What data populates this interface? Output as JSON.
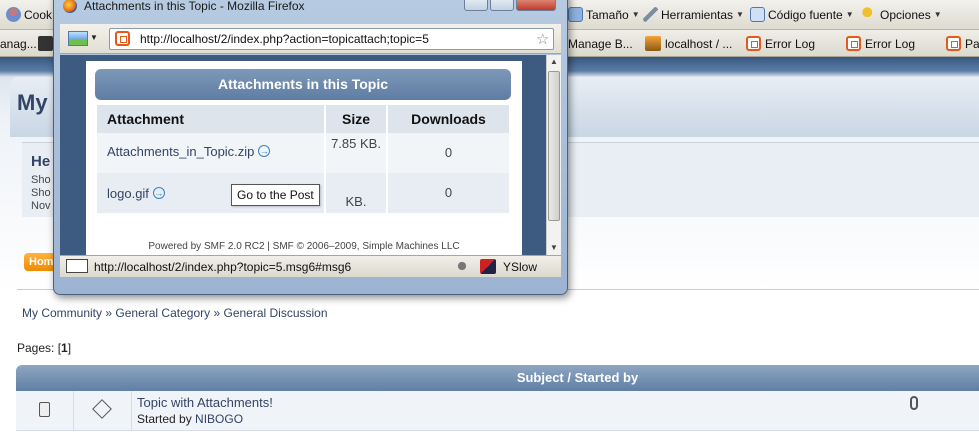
{
  "bg_toolbar": {
    "cookies_label": "Cook",
    "tamano_label": "Tamaño",
    "herramientas_label": "Herramientas",
    "codigo_label": "Código fuente",
    "opciones_label": "Opciones"
  },
  "bg_bookmarks": {
    "items": [
      "anag...",
      "Manage B...",
      "localhost / ...",
      "Error Log",
      "Error Log",
      "Pa"
    ]
  },
  "bg_page": {
    "community_title": "My",
    "hello": "He",
    "user_lines": [
      "Sho",
      "Sho",
      "Nov"
    ],
    "home_tab": "Hom",
    "breadcrumb": [
      "My Community",
      "General Category",
      "General Discussion"
    ],
    "breadcrumb_sep": "»",
    "pages_label": "Pages:",
    "current_page": "1",
    "table_header": "Subject / Started by",
    "topic": {
      "subject": "Topic with Attachments!",
      "started_by_label": "Started by",
      "author": "NIBOGO"
    }
  },
  "popup": {
    "window_title": "Attachments in this Topic - Mozilla Firefox",
    "url": "http://localhost/2/index.php?action=topicattach;topic=5",
    "panel_title": "Attachments in this Topic",
    "columns": [
      "Attachment",
      "Size",
      "Downloads"
    ],
    "rows": [
      {
        "name": "Attachments_in_Topic.zip",
        "size": "7.85 KB.",
        "downloads": "0"
      },
      {
        "name": "logo.gif",
        "size": "KB.",
        "downloads": "0"
      }
    ],
    "tooltip": "Go to the Post",
    "powered_by": "Powered by SMF 2.0 RC2 | SMF © 2006–2009, Simple Machines LLC",
    "status_url": "http://localhost/2/index.php?topic=5.msg6#msg6",
    "yslow": "YSlow"
  },
  "colors": {
    "accent_blue": "#334466",
    "header_blue": "#5f7da3",
    "home_orange": "#f08a00",
    "xampp_orange": "#e25a1c"
  }
}
